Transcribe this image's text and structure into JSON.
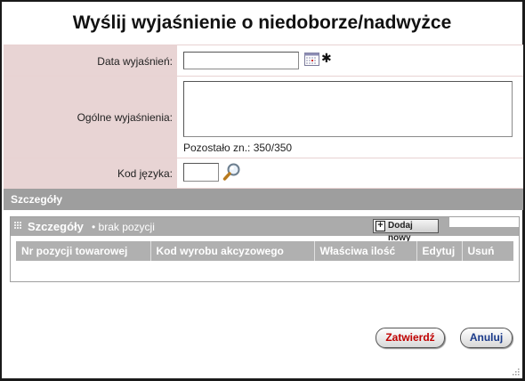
{
  "dialog": {
    "title": "Wyślij wyjaśnienie o niedoborze/nadwyżce"
  },
  "form": {
    "date": {
      "label": "Data wyjaśnień:",
      "value": "",
      "required_mark": "✱"
    },
    "explanation": {
      "label": "Ogólne wyjaśnienia:",
      "value": "",
      "remaining": "Pozostało zn.: 350/350"
    },
    "language": {
      "label": "Kod języka:",
      "value": ""
    }
  },
  "section": {
    "title": "Szczegóły"
  },
  "details": {
    "title": "Szczegóły",
    "subtitle": "• brak pozycji",
    "add_label": "Dodaj nowy",
    "columns": [
      "Nr pozycji towarowej",
      "Kod wyrobu akcyzowego",
      "Właściwa ilość",
      "Edytuj",
      "Usuń"
    ],
    "rows": []
  },
  "footer": {
    "confirm_label": "Zatwierdź",
    "cancel_label": "Anuluj"
  },
  "colors": {
    "label_bg": "#e8d4d4",
    "section_bar": "#9e9e9e",
    "confirm_text": "#c00000",
    "cancel_text": "#1a3a8a"
  }
}
